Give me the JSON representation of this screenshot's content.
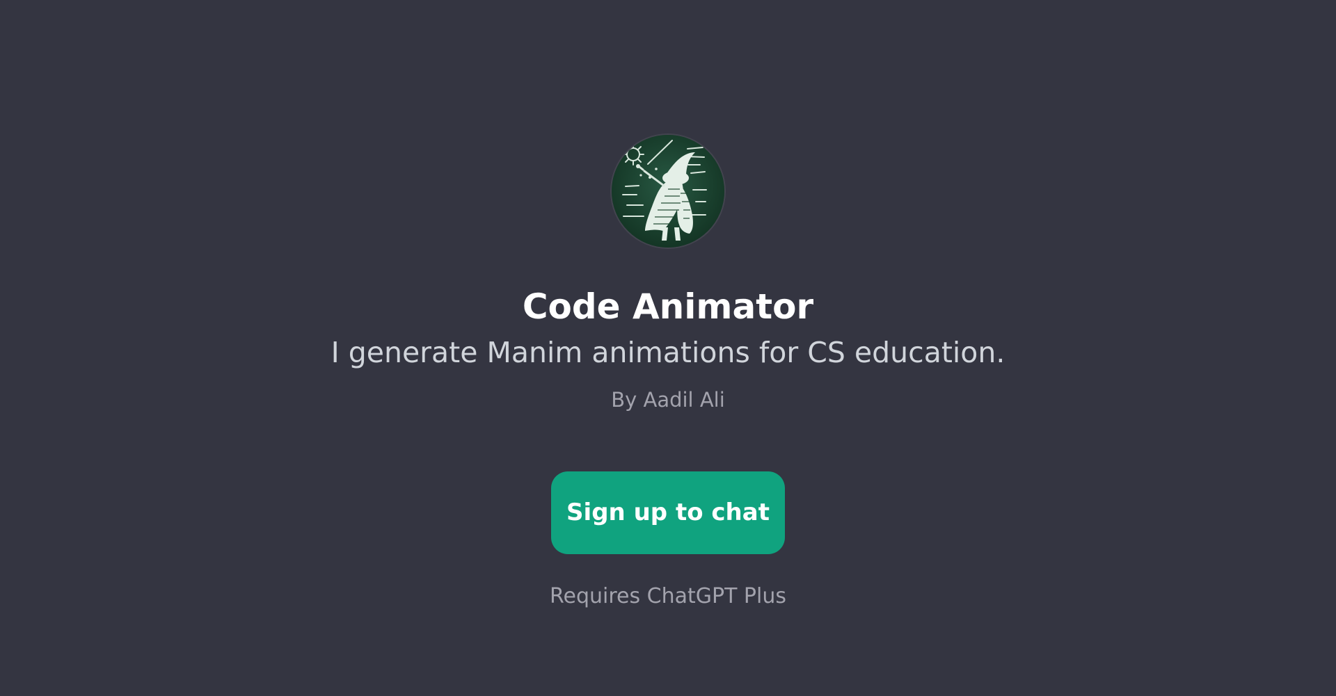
{
  "gpt": {
    "name": "Code Animator",
    "description": "I generate Manim animations for CS education.",
    "author": "By Aadil Ali",
    "cta_label": "Sign up to chat",
    "requirement": "Requires ChatGPT Plus"
  },
  "colors": {
    "background": "#343541",
    "accent": "#10a37f",
    "title": "#ffffff",
    "subtitle": "#d1d5db",
    "muted": "#a3a3ad"
  },
  "icons": {
    "avatar": "code-wizard-avatar-icon"
  }
}
